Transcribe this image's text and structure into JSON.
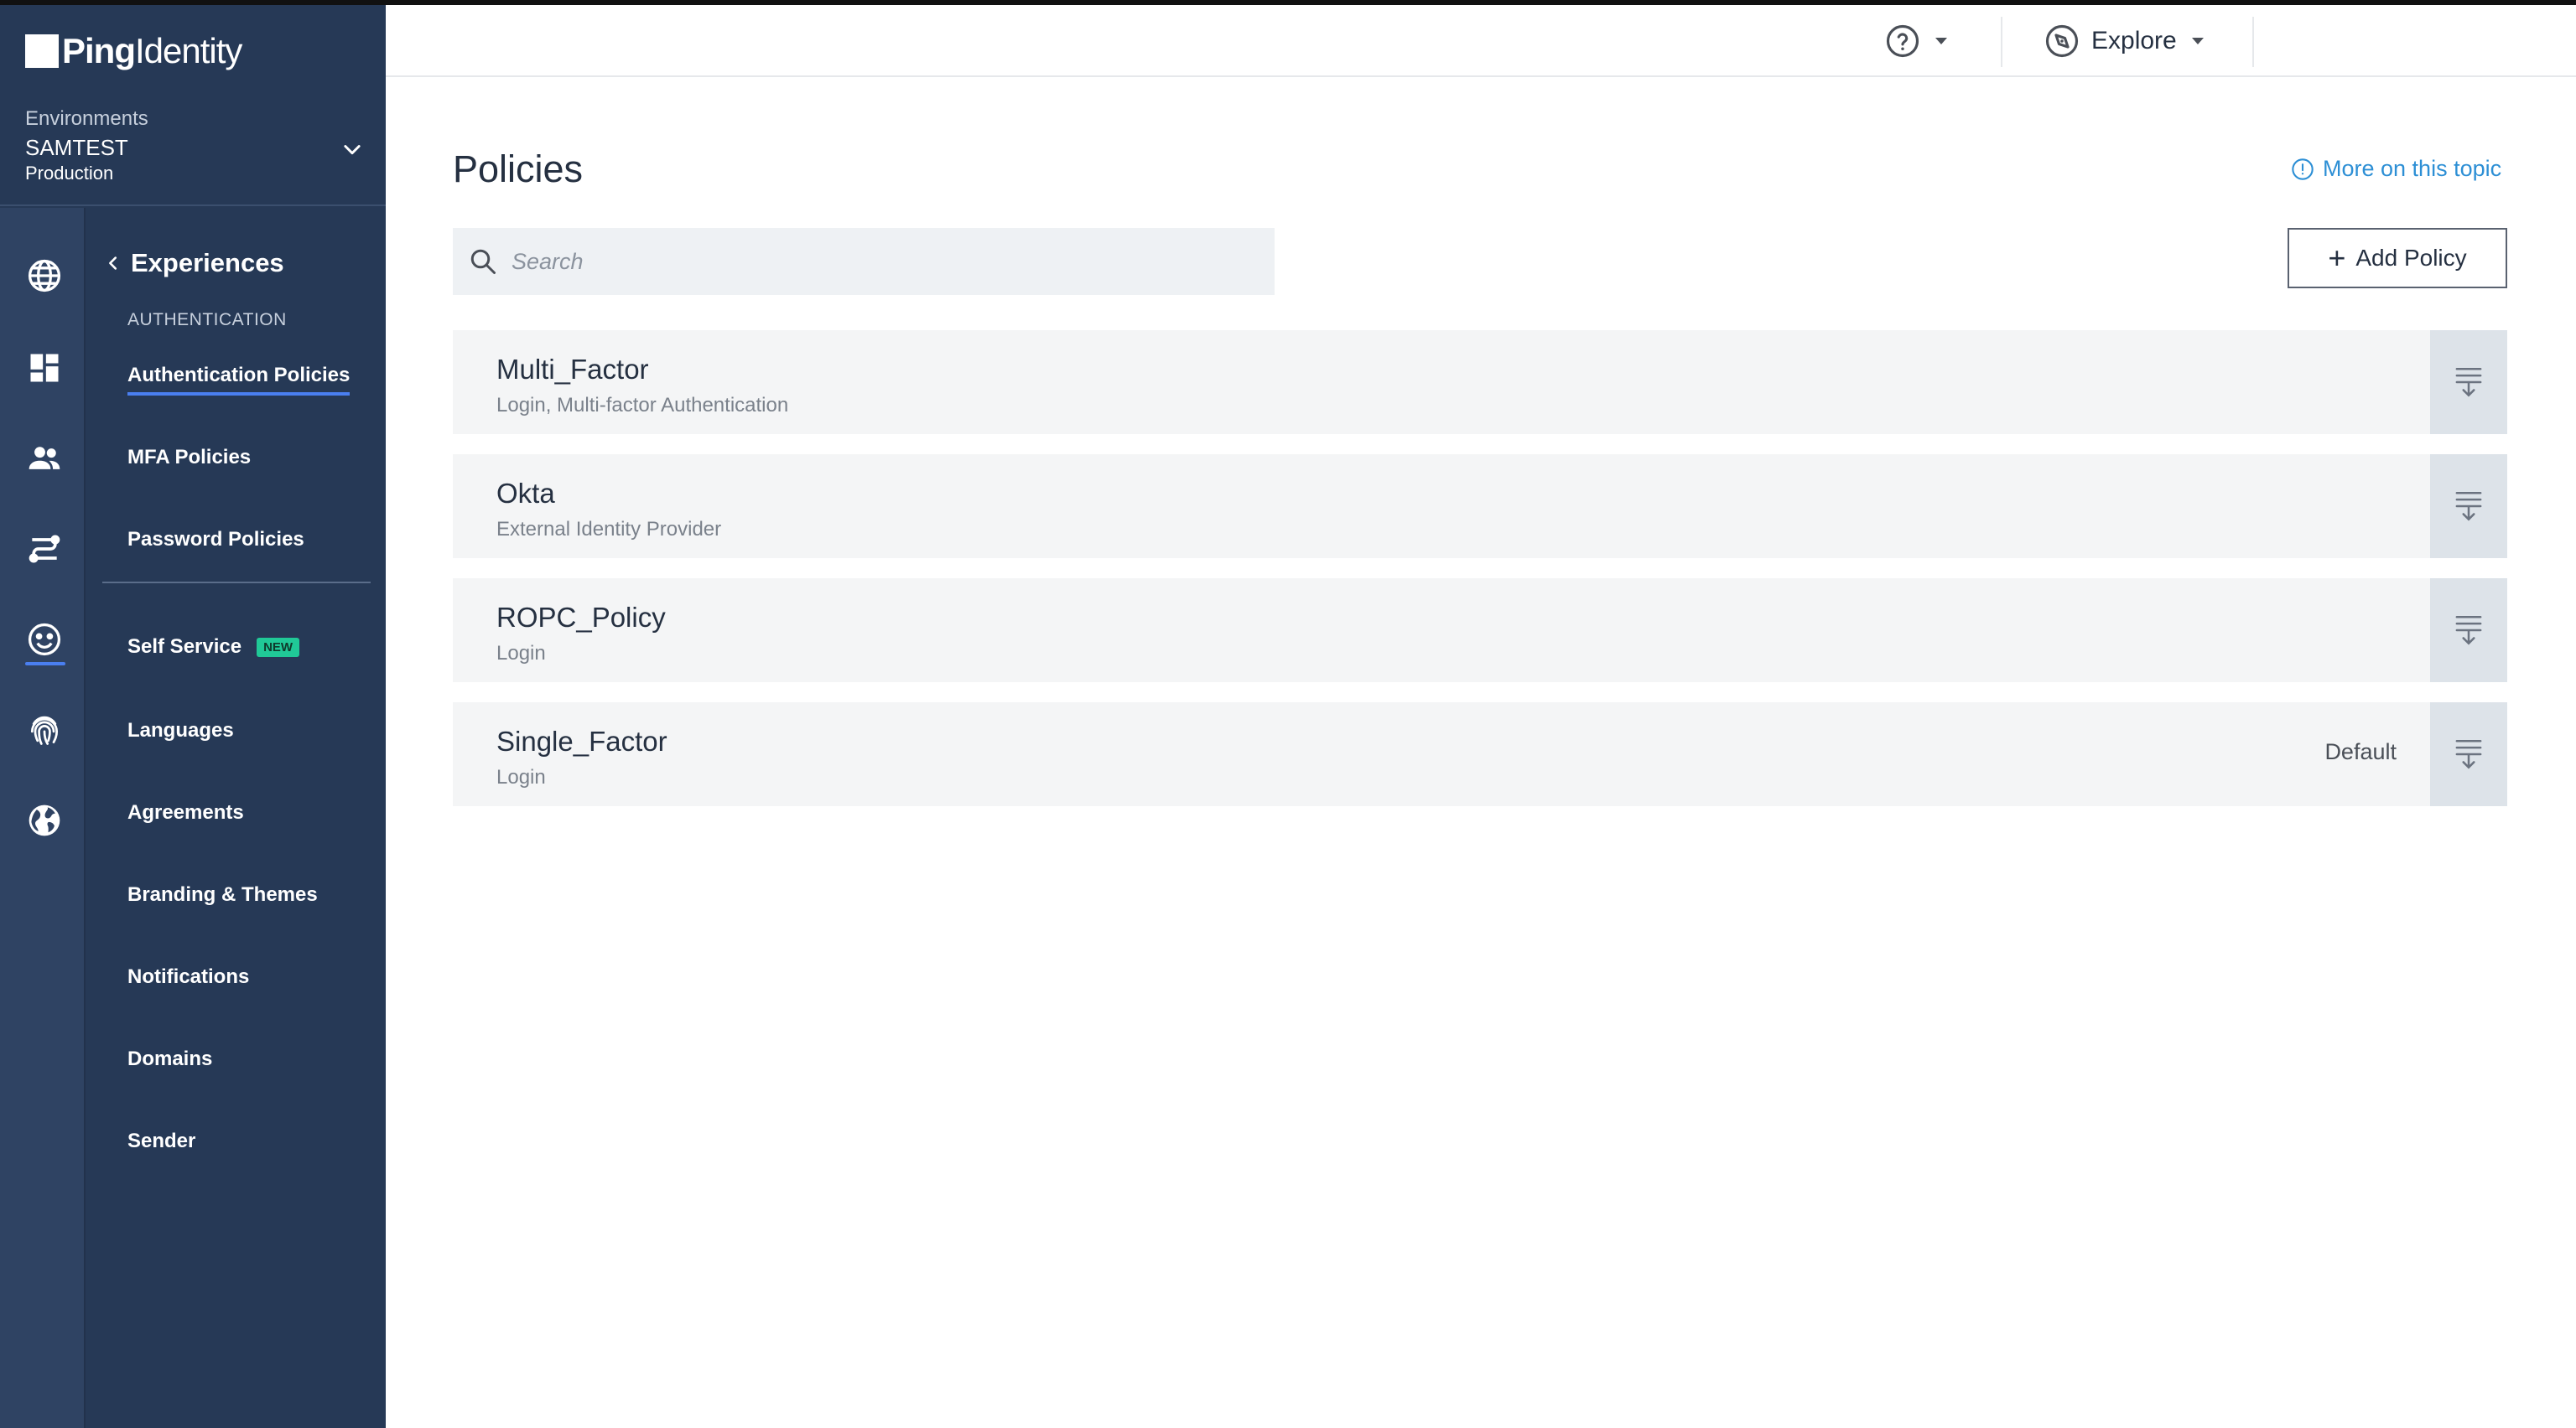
{
  "brand": {
    "bold": "Ping",
    "light": "Identity"
  },
  "environment": {
    "label": "Environments",
    "name": "SAMTEST",
    "type": "Production"
  },
  "nav": {
    "back_label": "Experiences",
    "section_label": "AUTHENTICATION",
    "items": [
      {
        "label": "Authentication Policies"
      },
      {
        "label": "MFA Policies"
      },
      {
        "label": "Password Policies"
      },
      {
        "label": "Self Service",
        "badge": "NEW"
      },
      {
        "label": "Languages"
      },
      {
        "label": "Agreements"
      },
      {
        "label": "Branding & Themes"
      },
      {
        "label": "Notifications"
      },
      {
        "label": "Domains"
      },
      {
        "label": "Sender"
      }
    ]
  },
  "topbar": {
    "explore_label": "Explore"
  },
  "main": {
    "title": "Policies",
    "more_link": "More on this topic",
    "search_placeholder": "Search",
    "add_button": "Add Policy",
    "policies": [
      {
        "name": "Multi_Factor",
        "description": "Login, Multi-factor Authentication",
        "tag": ""
      },
      {
        "name": "Okta",
        "description": "External Identity Provider",
        "tag": ""
      },
      {
        "name": "ROPC_Policy",
        "description": "Login",
        "tag": ""
      },
      {
        "name": "Single_Factor",
        "description": "Login",
        "tag": "Default"
      }
    ]
  },
  "colors": {
    "sidebar_bg": "#263956",
    "rail_bg": "#2f4363",
    "accent_blue": "#4a7ff0",
    "link_blue": "#2d8fd5",
    "badge_green": "#20c997",
    "row_bg": "#f4f5f6",
    "handle_bg": "#dde3e9"
  },
  "icons": {
    "rail": [
      "globe-grid-icon",
      "dashboard-icon",
      "users-icon",
      "connections-icon",
      "smiley-icon",
      "fingerprint-icon",
      "world-icon"
    ],
    "topbar": [
      "help-circle-icon",
      "compass-icon"
    ],
    "row_handle": "reorder-handle-icon"
  }
}
